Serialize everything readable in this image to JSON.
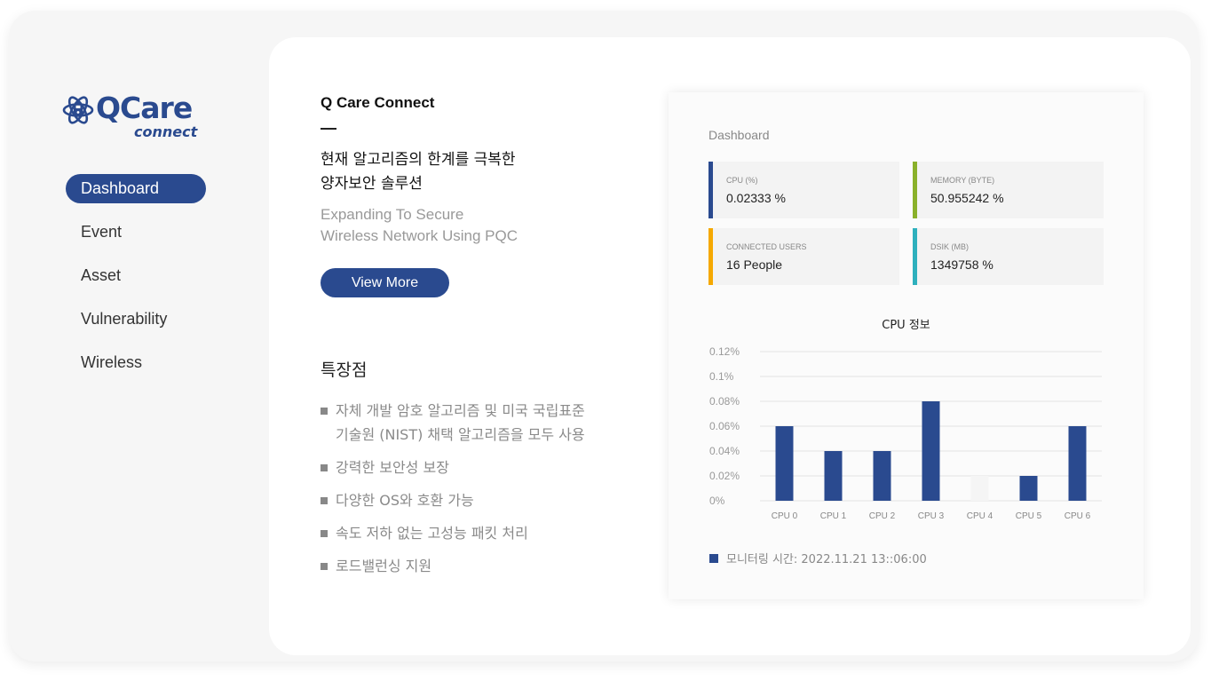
{
  "logo": {
    "word": "QCare",
    "sub": "connect"
  },
  "nav": {
    "items": [
      {
        "label": "Dashboard",
        "active": true
      },
      {
        "label": "Event",
        "active": false
      },
      {
        "label": "Asset",
        "active": false
      },
      {
        "label": "Vulnerability",
        "active": false
      },
      {
        "label": "Wireless",
        "active": false
      }
    ]
  },
  "intro": {
    "brand_title": "Q Care Connect",
    "headline_line1": "현재 알고리즘의 한계를 극복한",
    "headline_line2": "양자보안 솔루션",
    "sub_line1": "Expanding To Secure",
    "sub_line2": "Wireless Network Using PQC",
    "button_label": "View More"
  },
  "features": {
    "title": "특장점",
    "items": [
      {
        "line1": "자체 개발 암호 알고리즘 및 미국 국립표준",
        "line2": "기술원 (NIST) 채택 알고리즘을 모두 사용"
      },
      {
        "line1": "강력한 보안성 보장",
        "line2": ""
      },
      {
        "line1": "다양한 OS와 호환 가능",
        "line2": ""
      },
      {
        "line1": "속도 저하 없는 고성능 패킷 처리",
        "line2": ""
      },
      {
        "line1": "로드밸런싱 지원",
        "line2": ""
      }
    ]
  },
  "dashboard": {
    "title": "Dashboard",
    "stats": [
      {
        "label": "CPU (%)",
        "value": "0.02333 %",
        "color": "#2a4a8f"
      },
      {
        "label": "MEMORY (BYTE)",
        "value": "50.955242 %",
        "color": "#8ab12a"
      },
      {
        "label": "CONNECTED USERS",
        "value": "16 People",
        "color": "#f5a800"
      },
      {
        "label": "DSIK (MB)",
        "value": "1349758 %",
        "color": "#2eb0bd"
      }
    ],
    "legend": "모니터링 시간: 2022.11.21 13::06:00"
  },
  "chart_data": {
    "type": "bar",
    "title": "CPU 정보",
    "categories": [
      "CPU 0",
      "CPU 1",
      "CPU 2",
      "CPU 3",
      "CPU 4",
      "CPU 5",
      "CPU 6"
    ],
    "values": [
      0.06,
      0.04,
      0.04,
      0.08,
      0.02,
      0.02,
      0.06
    ],
    "bar_colors": [
      "#2a4a8f",
      "#2a4a8f",
      "#2a4a8f",
      "#2a4a8f",
      "#f5f5f5",
      "#2a4a8f",
      "#2a4a8f"
    ],
    "y_ticks": [
      "0%",
      "0.02%",
      "0.04%",
      "0.06%",
      "0.08%",
      "0.1%",
      "0.12%"
    ],
    "ylim": [
      0,
      0.12
    ],
    "grid": true,
    "legend": "bottom-left"
  }
}
